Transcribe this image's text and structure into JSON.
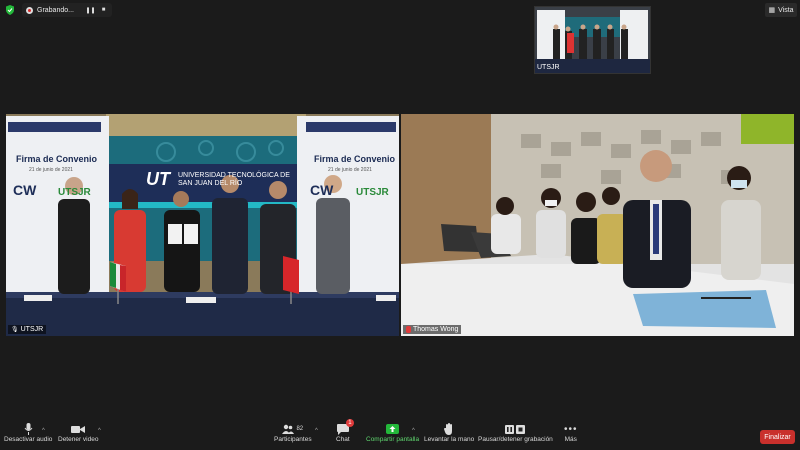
{
  "topbar": {
    "recording_label": "Grabando...",
    "view_label": "Vista"
  },
  "thumbnail": {
    "participant_name": "UTSJR"
  },
  "tiles": {
    "left": {
      "participant_name": "UTSJR",
      "backdrop_left_title": "Firma de Convenio",
      "backdrop_left_date": "21 de junio de 2021",
      "backdrop_right_title": "Firma de Convenio",
      "backdrop_right_date": "21 de junio de 2021",
      "banner_logo": "UT",
      "banner_text": "UNIVERSIDAD TECNOLÓGICA DE SAN JUAN DEL RÍO",
      "logo_cw": "CW",
      "logo_utsjr": "UTSJR"
    },
    "right": {
      "participant_name": "Thomas Wong"
    }
  },
  "toolbar": {
    "mute_label": "Desactivar audio",
    "video_label": "Detener video",
    "participants_label": "Participantes",
    "participants_count": "82",
    "chat_label": "Chat",
    "chat_badge": "1",
    "share_label": "Compartir pantalla",
    "raise_hand_label": "Levantar la mano",
    "pause_rec_label": "Pausar/detener grabación",
    "more_label": "Más",
    "end_label": "Finalizar"
  },
  "colors": {
    "background": "#1b1b1b",
    "end_button": "#c9302c",
    "share_green": "#23b83a",
    "recording_red": "#d92b2b"
  }
}
